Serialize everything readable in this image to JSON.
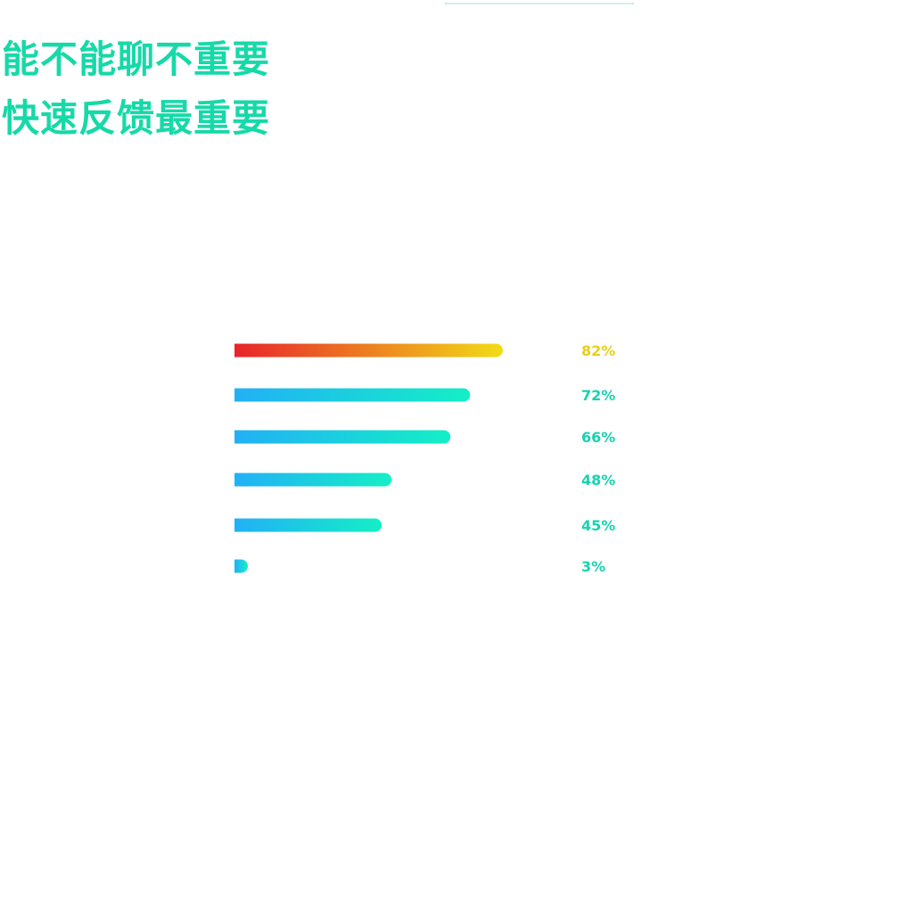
{
  "headline": {
    "line1": "能不能聊不重要",
    "line2": "快速反馈最重要"
  },
  "colors": {
    "headline": "#16d9a8",
    "highlight_gradient": [
      "#e8232a",
      "#f2dc17"
    ],
    "bar_gradient": [
      "#22b0f6",
      "#14efc6"
    ],
    "highlight_label": "#e8cf1c",
    "label": "#16d3b0",
    "top_line": "#a6e3df"
  },
  "chart_data": {
    "type": "bar",
    "orientation": "horizontal",
    "values": [
      82,
      72,
      66,
      48,
      45,
      3
    ],
    "labels": [
      "82%",
      "72%",
      "66%",
      "48%",
      "45%",
      "3%"
    ],
    "highlight_index": 0,
    "xlim": [
      0,
      100
    ],
    "grid": false
  }
}
